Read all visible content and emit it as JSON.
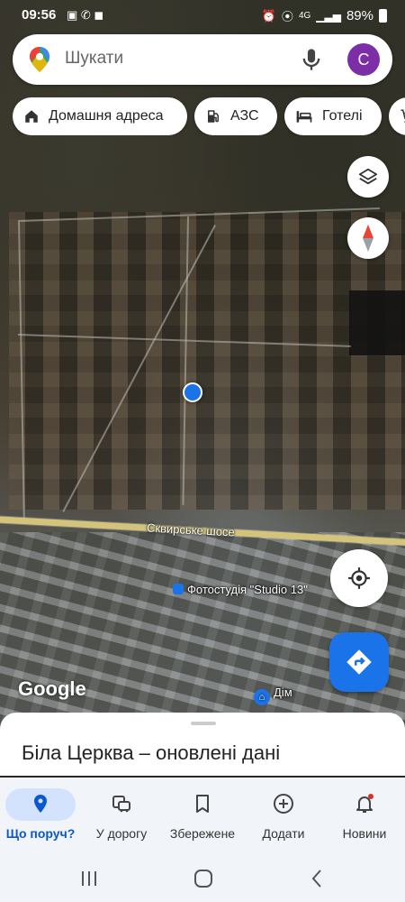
{
  "status": {
    "time": "09:56",
    "battery": "89%",
    "network": "4G"
  },
  "search": {
    "placeholder": "Шукати",
    "avatar_letter": "С"
  },
  "chips": [
    {
      "label": "Домашня адреса",
      "icon": "home-icon"
    },
    {
      "label": "АЗС",
      "icon": "gas-station-icon"
    },
    {
      "label": "Готелі",
      "icon": "hotel-icon"
    },
    {
      "label": "",
      "icon": "cart-icon"
    }
  ],
  "map": {
    "road_label": "Сквирське шосе",
    "poi_label": "Фотостудія \"Studio 13\"",
    "home_label": "Дім",
    "attribution": "Google"
  },
  "sheet": {
    "title": "Біла Церква – оновлені дані"
  },
  "nav": [
    {
      "label": "Що поруч?",
      "icon": "location-pin-icon",
      "active": true
    },
    {
      "label": "У дорогу",
      "icon": "commute-icon",
      "active": false
    },
    {
      "label": "Збережене",
      "icon": "bookmark-icon",
      "active": false
    },
    {
      "label": "Додати",
      "icon": "add-circle-icon",
      "active": false
    },
    {
      "label": "Новини",
      "icon": "bell-icon",
      "active": false,
      "badge": true
    }
  ],
  "colors": {
    "accent": "#1a73e8",
    "avatar": "#7b2ea5",
    "nav_active_pill": "#d3e3fd"
  }
}
